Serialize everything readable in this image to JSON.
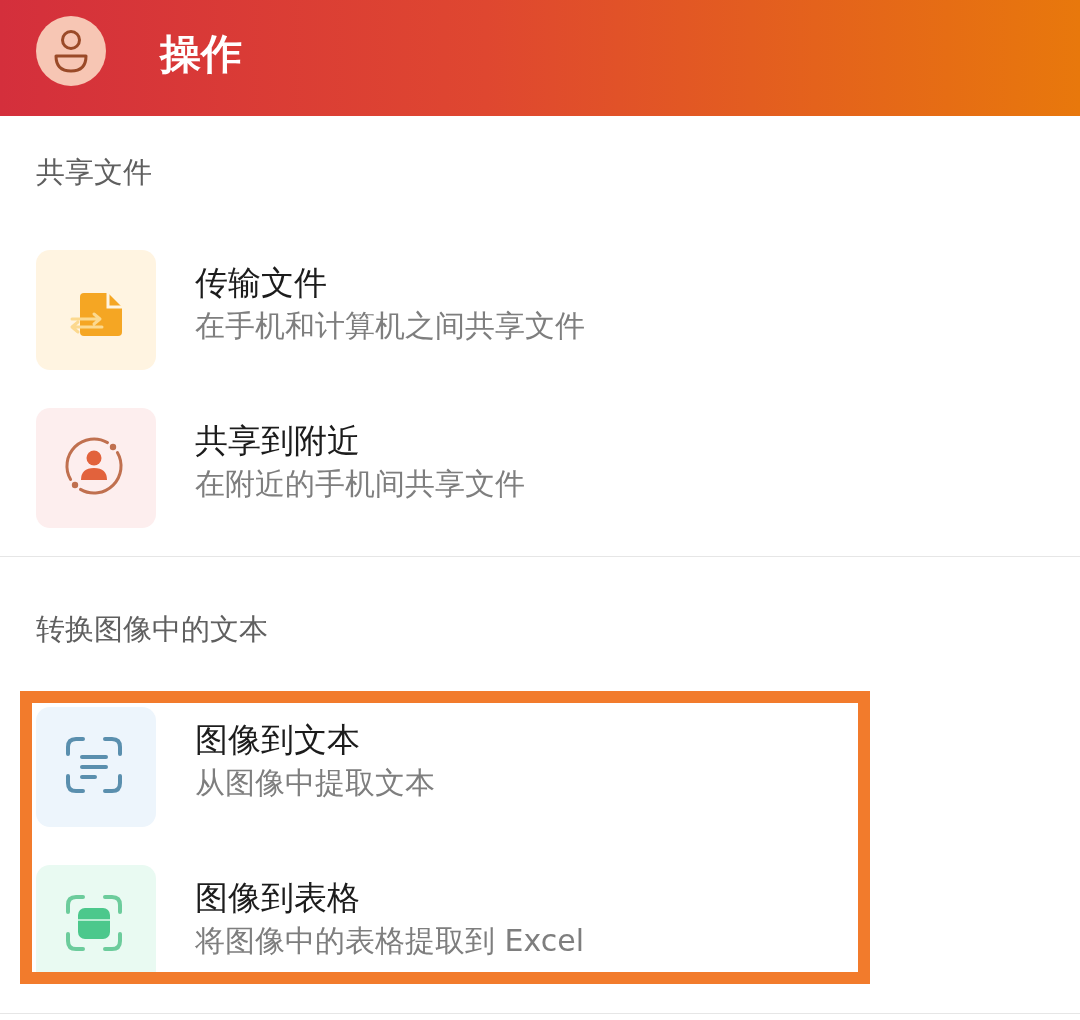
{
  "header": {
    "title": "操作"
  },
  "sections": [
    {
      "heading": "共享文件",
      "highlighted": false,
      "items": [
        {
          "kind": "file-transfer",
          "title": "传输文件",
          "subtitle": "在手机和计算机之间共享文件"
        },
        {
          "kind": "nearby-share",
          "title": "共享到附近",
          "subtitle": "在附近的手机间共享文件"
        }
      ]
    },
    {
      "heading": "转换图像中的文本",
      "highlighted": true,
      "items": [
        {
          "kind": "scan-text",
          "title": "图像到文本",
          "subtitle": "从图像中提取文本"
        },
        {
          "kind": "scan-table",
          "title": "图像到表格",
          "subtitle": "将图像中的表格提取到 Excel"
        }
      ]
    }
  ]
}
